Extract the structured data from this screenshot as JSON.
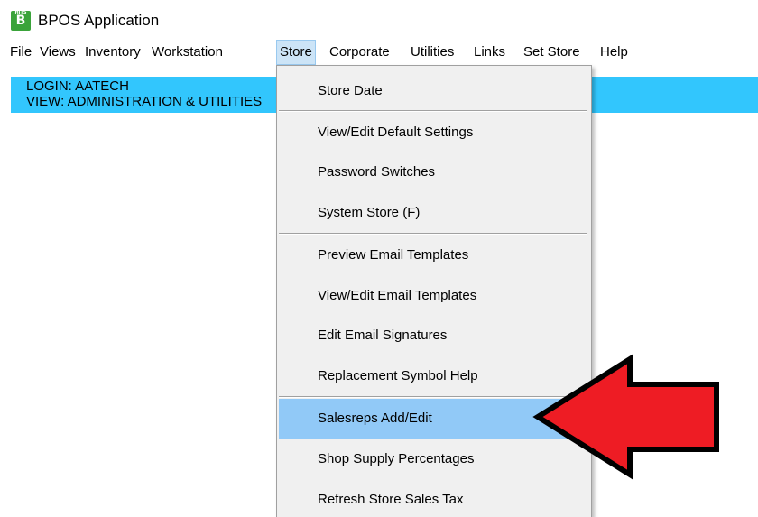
{
  "window": {
    "icon_text": "B",
    "icon_small_text": "HITS",
    "title": "BPOS Application"
  },
  "menubar": [
    {
      "label": "File"
    },
    {
      "label": "Views"
    },
    {
      "label": "Inventory"
    },
    {
      "label": "Workstation"
    },
    {
      "label": "Store"
    },
    {
      "label": "Corporate"
    },
    {
      "label": "Utilities"
    },
    {
      "label": "Links"
    },
    {
      "label": "Set Store"
    },
    {
      "label": "Help"
    }
  ],
  "banner": {
    "login": "LOGIN: AATECH",
    "view": "VIEW: ADMINISTRATION & UTILITIES"
  },
  "store_menu": {
    "items": [
      {
        "label": "Store Date"
      },
      {
        "label": "View/Edit Default Settings"
      },
      {
        "label": "Password Switches"
      },
      {
        "label": "System Store  (F)"
      },
      {
        "label": "Preview Email Templates"
      },
      {
        "label": "View/Edit Email Templates"
      },
      {
        "label": "Edit Email Signatures"
      },
      {
        "label": "Replacement Symbol Help"
      },
      {
        "label": "Salesreps Add/Edit"
      },
      {
        "label": "Shop Supply Percentages"
      },
      {
        "label": "Refresh Store Sales Tax"
      }
    ],
    "highlighted": "Salesreps Add/Edit"
  },
  "colors": {
    "banner": "#32c6fd",
    "menu_highlight": "#91c9f7",
    "arrow_fill": "#ee1c24",
    "icon_green": "#3aa33a"
  }
}
